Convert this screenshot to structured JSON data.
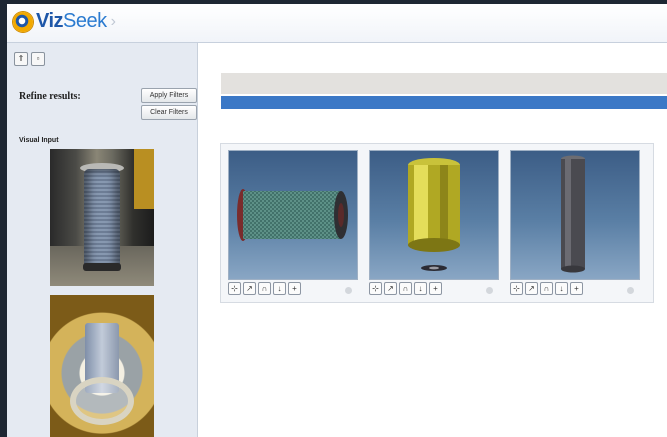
{
  "header": {
    "logo_viz": "Viz",
    "logo_seek": "Seek",
    "breadcrumb_chevron": "›"
  },
  "toolbar": {
    "button1_glyph": "⇑",
    "button2_glyph": "▫"
  },
  "filters": {
    "refine_label": "Refine results:",
    "apply_label": "Apply Filters",
    "clear_label": "Clear Filters",
    "visual_input_label": "Visual Input"
  },
  "colors": {
    "accent_blue": "#3b78c6",
    "logo_orange": "#f2a900",
    "logo_blue": "#1e57a8"
  },
  "results": [
    {
      "model": "green-mesh-cylinder",
      "tools": [
        "⊹",
        "↗",
        "∩",
        "↓",
        "+"
      ]
    },
    {
      "model": "yellow-canister",
      "tools": [
        "⊹",
        "↗",
        "∩",
        "↓",
        "+"
      ]
    },
    {
      "model": "gray-tube",
      "tools": [
        "⊹",
        "↗",
        "∩",
        "↓",
        "+"
      ]
    }
  ]
}
